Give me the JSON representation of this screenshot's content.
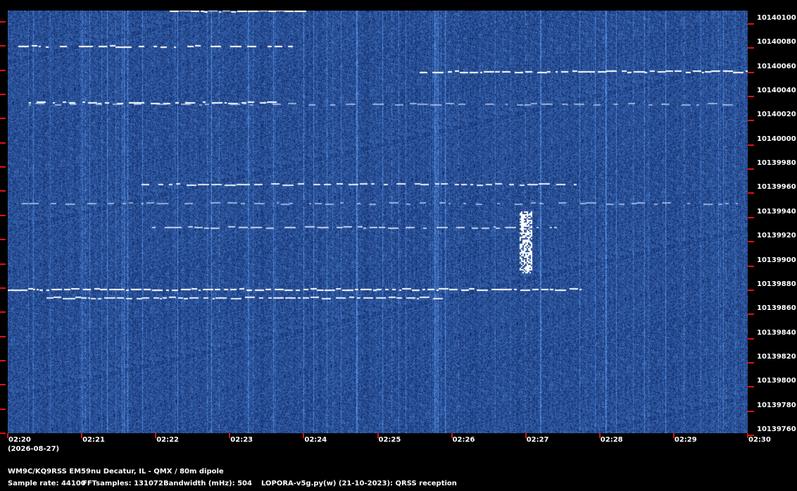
{
  "spectrogram": {
    "frequency_labels": [
      "10140100",
      "10140080",
      "10140060",
      "10140040",
      "10140020",
      "10140000",
      "10139980",
      "10139960",
      "10139940",
      "10139920",
      "10139900",
      "10139880",
      "10139860",
      "10139840",
      "10139820",
      "10139800",
      "10139780",
      "10139760"
    ],
    "time_labels": [
      "02:20",
      "02:21",
      "02:22",
      "02:23",
      "02:24",
      "02:25",
      "02:26",
      "02:27",
      "02:28",
      "02:29",
      "02:30"
    ],
    "date": "(2026-08-27)",
    "background_color": "#0b2a66",
    "signal_color": "#ffffff",
    "tick_color": "#e01010"
  },
  "footer": {
    "station": "WM9C/KQ9RSS EM59nu Decatur, IL - QMX / 80m dipole",
    "sample_rate": "Sample rate: 44100",
    "fft_samples": "FFTsamples: 131072",
    "bandwidth": "Bandwidth (mHz): 504",
    "software": "LOPORA-v5g.py(w) (21-10-2023): QRSS reception"
  }
}
